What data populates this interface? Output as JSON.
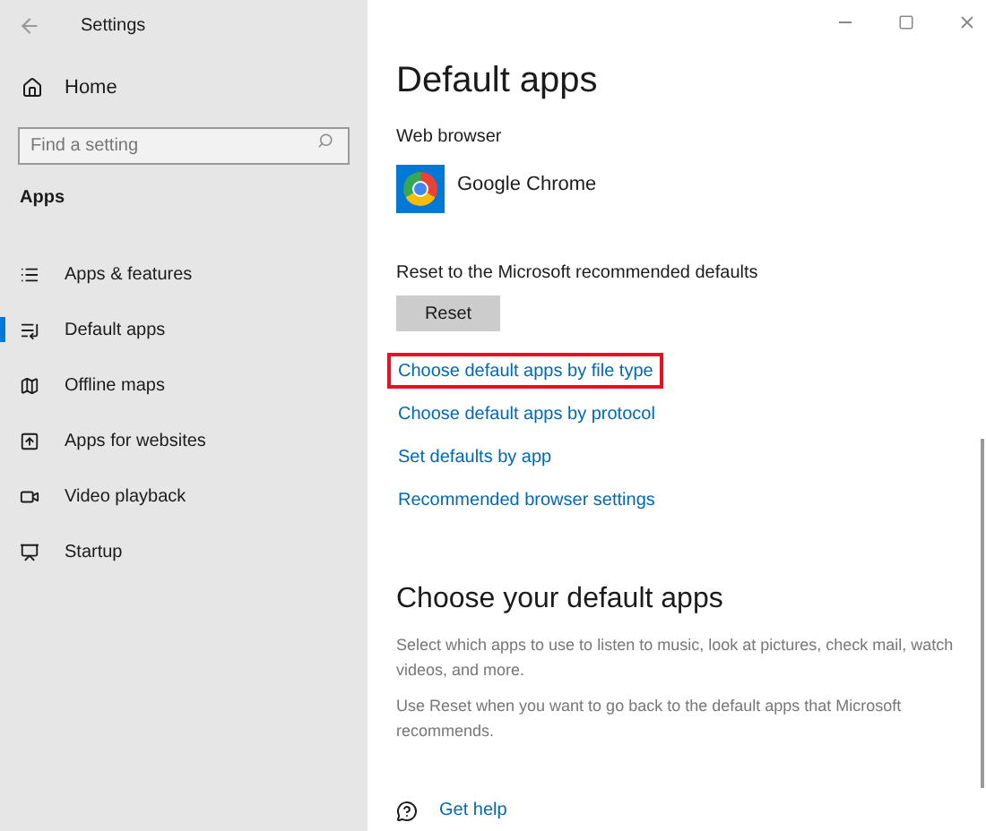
{
  "window": {
    "title": "Settings"
  },
  "sidebar": {
    "home": "Home",
    "search": {
      "placeholder": "Find a setting"
    },
    "section": "Apps",
    "items": [
      {
        "label": "Apps & features",
        "selected": false
      },
      {
        "label": "Default apps",
        "selected": true
      },
      {
        "label": "Offline maps",
        "selected": false
      },
      {
        "label": "Apps for websites",
        "selected": false
      },
      {
        "label": "Video playback",
        "selected": false
      },
      {
        "label": "Startup",
        "selected": false
      }
    ]
  },
  "content": {
    "title": "Default apps",
    "web_browser_label": "Web browser",
    "browser": "Google Chrome",
    "reset_label": "Reset to the Microsoft recommended defaults",
    "reset_button": "Reset",
    "links": [
      {
        "label": "Choose default apps by file type",
        "highlighted": true
      },
      {
        "label": "Choose default apps by protocol",
        "highlighted": false
      },
      {
        "label": "Set defaults by app",
        "highlighted": false
      },
      {
        "label": "Recommended browser settings",
        "highlighted": false
      }
    ],
    "section_title": "Choose your default apps",
    "paragraphs": [
      "Select which apps to use to listen to music, look at pictures, check mail, watch videos, and more.",
      "Use Reset when you want to go back to the default apps that Microsoft recommends."
    ],
    "help": "Get help"
  }
}
